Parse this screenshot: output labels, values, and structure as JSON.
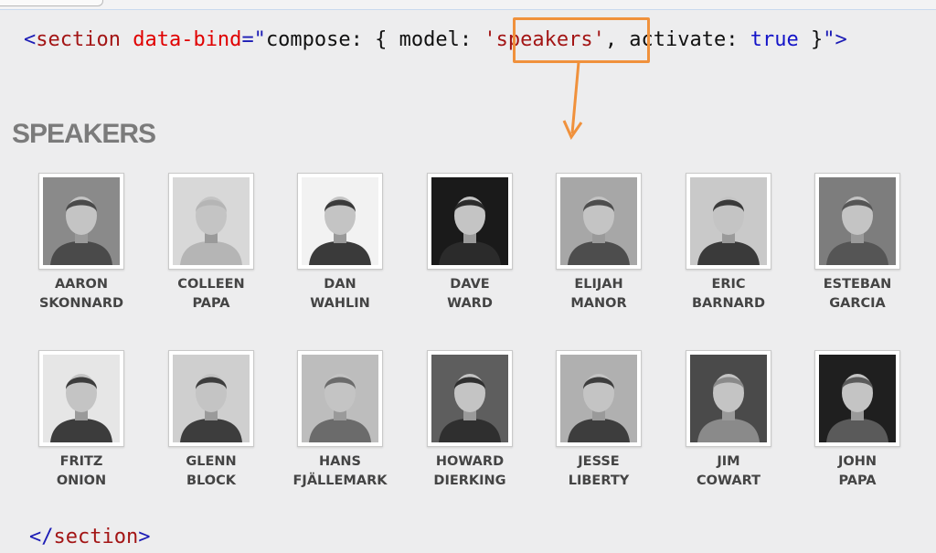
{
  "code": {
    "open_tag_start": "<",
    "tag_name": "section",
    "attr_name": "data-bind",
    "equals_quote": "=\"",
    "binding_prefix": "compose: { model: ",
    "model_value": "'speakers'",
    "binding_middle": ", activate: ",
    "activate_value": "true",
    "binding_suffix": " }",
    "close_quote_bracket": "\">",
    "close_tag_open": "</",
    "close_tag_name": "section",
    "close_tag_end": ">"
  },
  "page": {
    "heading": "SPEAKERS"
  },
  "speakers": [
    {
      "first": "AARON",
      "last": "SKONNARD",
      "shade": "#4a4a4a",
      "bg": "#8a8a8a"
    },
    {
      "first": "COLLEEN",
      "last": "PAPA",
      "shade": "#b5b5b5",
      "bg": "#d8d8d8"
    },
    {
      "first": "DAN",
      "last": "WAHLIN",
      "shade": "#3a3a3a",
      "bg": "#f2f2f2"
    },
    {
      "first": "DAVE",
      "last": "WARD",
      "shade": "#2b2b2b",
      "bg": "#1a1a1a"
    },
    {
      "first": "ELIJAH",
      "last": "MANOR",
      "shade": "#4d4d4d",
      "bg": "#a7a7a7"
    },
    {
      "first": "ERIC",
      "last": "BARNARD",
      "shade": "#3a3a3a",
      "bg": "#c9c9c9"
    },
    {
      "first": "ESTEBAN",
      "last": "GARCIA",
      "shade": "#555555",
      "bg": "#7d7d7d"
    },
    {
      "first": "FRITZ",
      "last": "ONION",
      "shade": "#3c3c3c",
      "bg": "#e6e6e6"
    },
    {
      "first": "GLENN",
      "last": "BLOCK",
      "shade": "#3d3d3d",
      "bg": "#cfcfcf"
    },
    {
      "first": "HANS",
      "last": "FJÄLLEMARK",
      "shade": "#6b6b6b",
      "bg": "#bdbdbd"
    },
    {
      "first": "HOWARD",
      "last": "DIERKING",
      "shade": "#2f2f2f",
      "bg": "#5e5e5e"
    },
    {
      "first": "JESSE",
      "last": "LIBERTY",
      "shade": "#3d3d3d",
      "bg": "#b0b0b0"
    },
    {
      "first": "JIM",
      "last": "COWART",
      "shade": "#8a8a8a",
      "bg": "#4a4a4a"
    },
    {
      "first": "JOHN",
      "last": "PAPA",
      "shade": "#5a5a5a",
      "bg": "#1f1f1f"
    }
  ],
  "colors": {
    "callout": "#f0913c",
    "heading": "#7b7b7b",
    "name_text": "#444444"
  }
}
